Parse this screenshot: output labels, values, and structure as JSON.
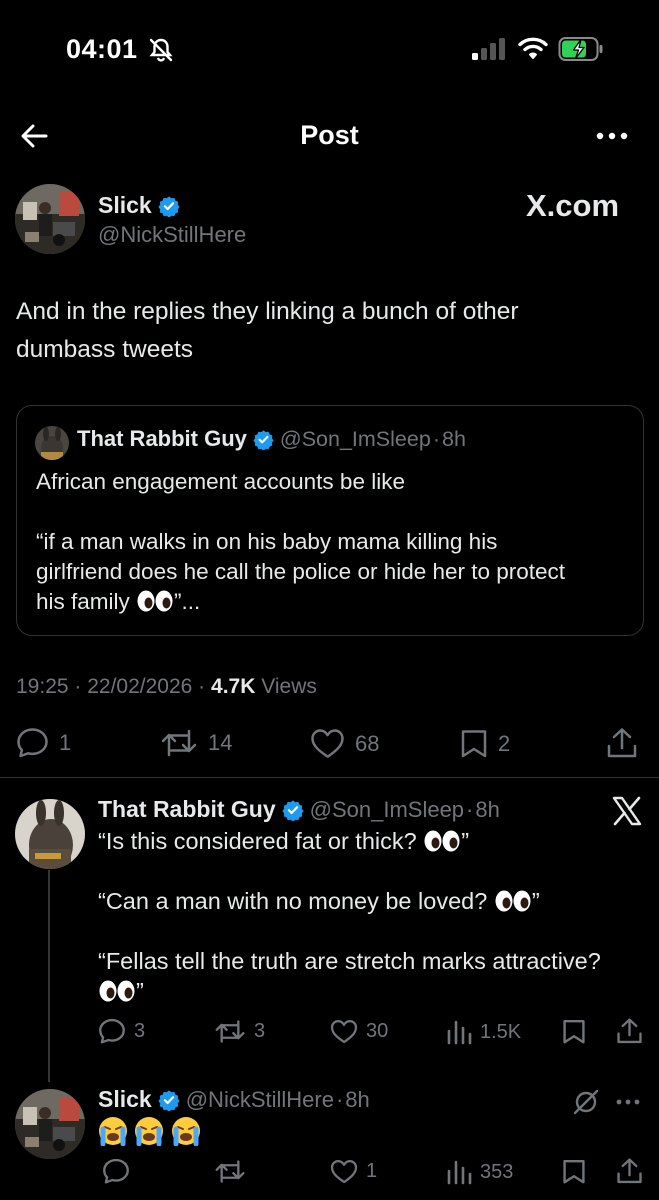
{
  "status_bar": {
    "time": "04:01"
  },
  "header": {
    "title": "Post"
  },
  "main_post": {
    "author_name": "Slick",
    "author_handle": "@NickStillHere",
    "x_label": "X.com",
    "text_line1": "And in the replies they linking a bunch of other",
    "text_line2": "dumbass tweets",
    "quote": {
      "author_name": "That Rabbit Guy",
      "author_handle": "@Son_ImSleep",
      "time": "8h",
      "line1": "African engagement accounts be like",
      "line2": "“if a man walks in on his baby mama killing his",
      "line3": "girlfriend does he call the police or hide her to protect",
      "line4_before": "his family ",
      "line4_after": "”..."
    },
    "meta": {
      "time": "19:25",
      "date": "22/02/2026",
      "views_count": "4.7K",
      "views_label": "Views"
    },
    "actions": {
      "replies": "1",
      "reposts": "14",
      "likes": "68",
      "bookmarks": "2"
    }
  },
  "reply1": {
    "author_name": "That Rabbit Guy",
    "author_handle": "@Son_ImSleep",
    "time": "8h",
    "line1_before": "“Is this considered fat or thick? ",
    "line1_after": "”",
    "line2_before": "“Can a man with no money be loved? ",
    "line2_after": "”",
    "line3": "“Fellas tell the truth are stretch marks attractive?",
    "line4_after": "”",
    "actions": {
      "replies": "3",
      "reposts": "3",
      "likes": "30",
      "views": "1.5K"
    }
  },
  "reply2": {
    "author_name": "Slick",
    "author_handle": "@NickStillHere",
    "time": "8h",
    "actions": {
      "likes": "1",
      "views": "353"
    }
  },
  "colors": {
    "background": "#000000",
    "accent": "#1d9bf0",
    "muted": "#71767b",
    "border": "#2f3336"
  }
}
